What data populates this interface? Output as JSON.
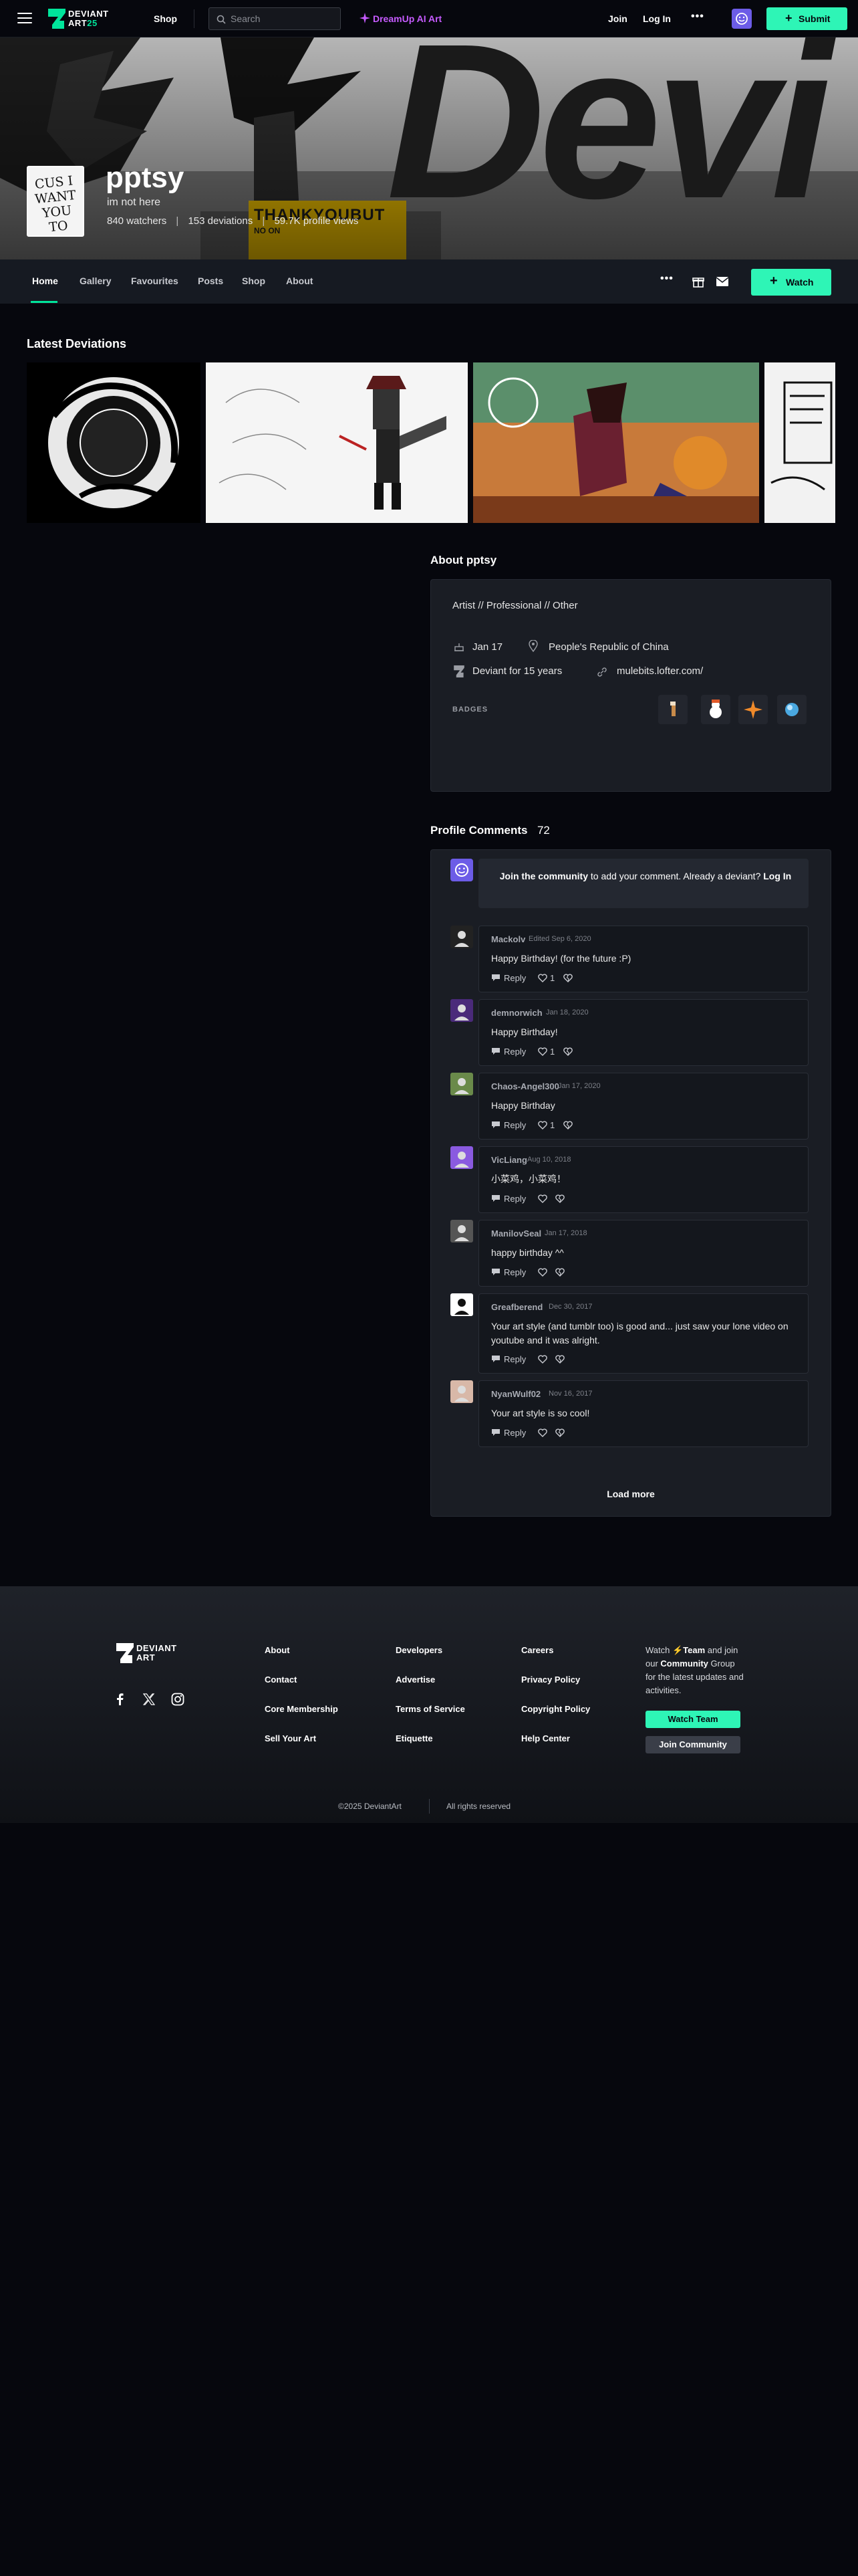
{
  "nav": {
    "logo_line1": "DEVIANT",
    "logo_line2": "ART",
    "logo_badge": "25",
    "shop": "Shop",
    "search_placeholder": "Search",
    "dreamup": "DreamUp AI Art",
    "join": "Join",
    "login": "Log In",
    "more": "•••",
    "submit": "Submit"
  },
  "banner": {
    "big_text": "Devi",
    "yellow_text": "THANKYOUBUT",
    "yellow_sub": "NO ON"
  },
  "profile": {
    "avatar_text": "CUS I WANT YOU TO",
    "username": "pptsy",
    "tagline": "im not here",
    "watchers": "840 watchers",
    "deviations": "153 deviations",
    "views": "59.7K profile views"
  },
  "tabs": [
    "Home",
    "Gallery",
    "Favourites",
    "Posts",
    "Shop",
    "About"
  ],
  "actions": {
    "watch": "Watch"
  },
  "latest": {
    "title": "Latest Deviations"
  },
  "about": {
    "title": "About pptsy",
    "roles": "Artist // Professional // Other",
    "birthday": "Jan 17",
    "location": "People's Republic of China",
    "deviant_for": "Deviant for 15 years",
    "website": "mulebits.lofter.com/",
    "badges_label": "BADGES"
  },
  "comments": {
    "title": "Profile Comments",
    "count": "72",
    "join_bold": "Join the community",
    "join_rest": " to add your comment. Already a deviant?",
    "login": "Log In",
    "reply_label": "Reply",
    "load_more": "Load more",
    "items": [
      {
        "user": "Mackolv",
        "date": "Edited Sep 6, 2020",
        "text": "Happy Birthday! (for the future :P)",
        "likes": "1"
      },
      {
        "user": "demnorwich",
        "date": "Jan 18, 2020",
        "text": "Happy Birthday!",
        "likes": "1"
      },
      {
        "user": "Chaos-Angel300",
        "date": "Jan 17, 2020",
        "text": "Happy Birthday",
        "likes": "1"
      },
      {
        "user": "VicLiang",
        "date": "Aug 10, 2018",
        "text": "小菜鸡，小菜鸡！",
        "likes": ""
      },
      {
        "user": "ManilovSeal",
        "date": "Jan 17, 2018",
        "text": "happy birthday ^^",
        "likes": ""
      },
      {
        "user": "Greafberend",
        "date": "Dec 30, 2017",
        "text": "Your art style (and tumblr too) is good and... just saw your lone video on youtube and it was alright.",
        "likes": ""
      },
      {
        "user": "NyanWulf02",
        "date": "Nov 16, 2017",
        "text": "Your art style is so cool!",
        "likes": ""
      }
    ]
  },
  "footer": {
    "logo_line1": "DEVIANT",
    "logo_line2": "ART",
    "col1": [
      "About",
      "Contact",
      "Core Membership",
      "Sell Your Art"
    ],
    "col2": [
      "Developers",
      "Advertise",
      "Terms of Service",
      "Etiquette"
    ],
    "col3": [
      "Careers",
      "Privacy Policy",
      "Copyright Policy",
      "Help Center"
    ],
    "cta_1": "Watch ",
    "cta_team": "Team",
    "cta_2": " and join our ",
    "cta_community": "Community",
    "cta_3": " Group for the latest updates and activities.",
    "watch_team": "Watch Team",
    "join_community": "Join Community",
    "copyright": "©2025 DeviantArt",
    "rights": "All rights reserved"
  },
  "colors": {
    "accent": "#00e59b",
    "mint": "#2ef5b6",
    "dreamup": "#c65bff",
    "bg": "#06070d",
    "card": "#1a1d24"
  }
}
